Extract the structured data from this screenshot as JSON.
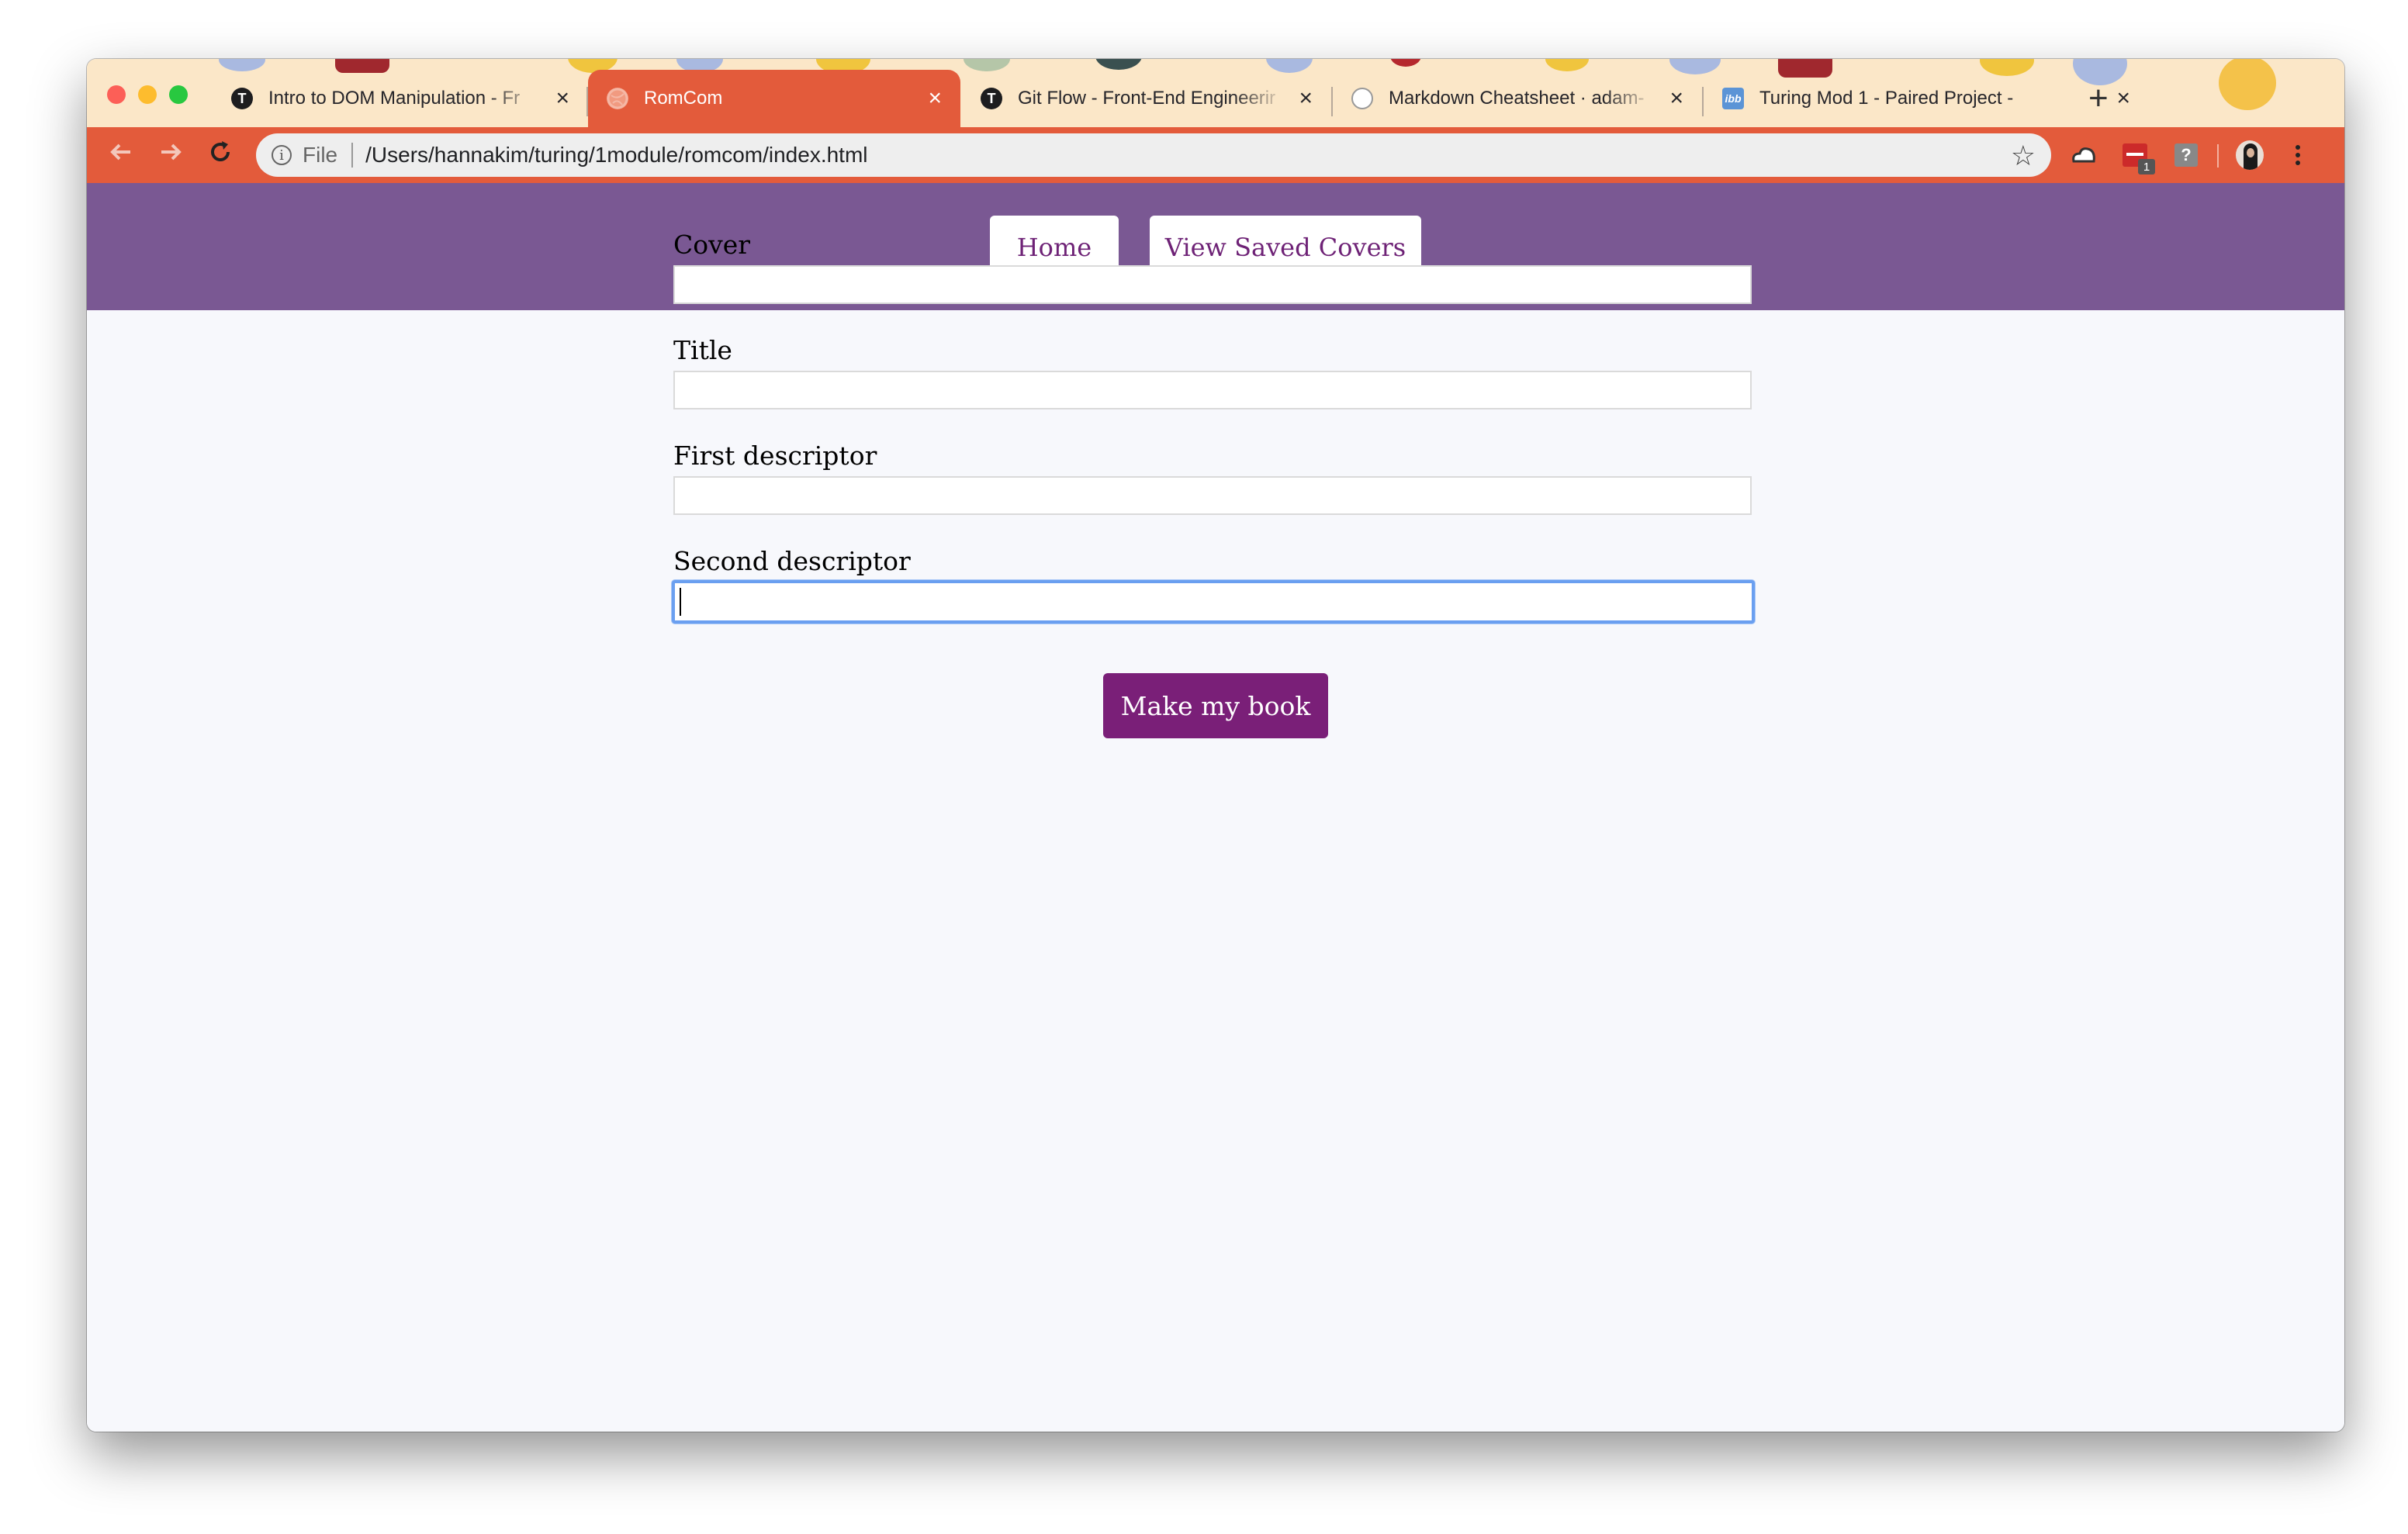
{
  "browser": {
    "tabs": [
      {
        "title": "Intro to DOM Manipulation - Fr",
        "icon": "turing-icon",
        "active": false
      },
      {
        "title": "RomCom",
        "icon": "globe-icon",
        "active": true
      },
      {
        "title": "Git Flow - Front-End Engineerir",
        "icon": "turing-icon",
        "active": false
      },
      {
        "title": "Markdown Cheatsheet · adam-",
        "icon": "github-icon",
        "active": false
      },
      {
        "title": "Turing Mod 1 - Paired Project -",
        "icon": "ibb-icon",
        "active": false
      }
    ],
    "new_tab_symbol": "+",
    "close_symbol": "×",
    "address": {
      "scheme_label": "File",
      "url": "/Users/hannakim/turing/1module/romcom/index.html"
    },
    "extension_badge": "1",
    "accent_color": "#e35b3b"
  },
  "page": {
    "nav": {
      "home_label": "Home",
      "saved_label": "View Saved Covers"
    },
    "form": {
      "cover_label": "Cover",
      "cover_value": "",
      "title_label": "Title",
      "title_value": "",
      "first_label": "First descriptor",
      "first_value": "",
      "second_label": "Second descriptor",
      "second_value": "",
      "submit_label": "Make my book"
    },
    "colors": {
      "header_bg": "#7a5893",
      "button_text": "#6e2276",
      "submit_bg": "#7a1f78"
    }
  }
}
